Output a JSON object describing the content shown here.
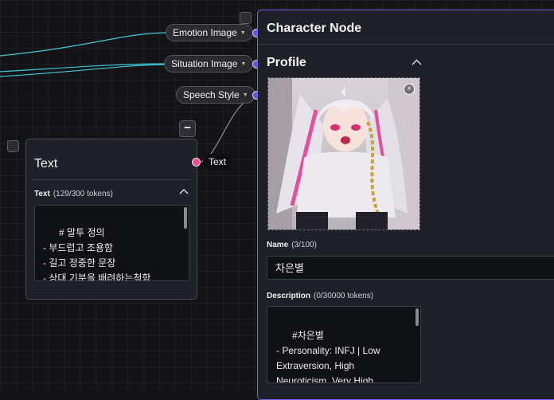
{
  "character_node": {
    "title": "Character Node",
    "inputs": [
      {
        "label": "Emotion Image"
      },
      {
        "label": "Situation Image"
      },
      {
        "label": "Speech Style"
      }
    ],
    "profile_section": "Profile",
    "name_field": {
      "label": "Name",
      "count": "(3/100)",
      "value": "차은별"
    },
    "description_field": {
      "label": "Description",
      "count": "(0/30000 tokens)",
      "value": "#차은별\n- Personality: INFJ | Low\nExtraversion, High\nNeuroticism, Very High\nOpenness, Moderate"
    }
  },
  "text_node": {
    "title": "Text",
    "field_label": "Text",
    "field_count": "(129/300 tokens)",
    "content": "# 말투 정의\n- 부드럽고 조용함\n- 길고 정중한 문장\n- 상대 기분을 배려하는척함\n- 말 자체는 부드러운데, 단어",
    "output_label": "Text"
  },
  "colors": {
    "accent": "#7a5cf0",
    "port_purple": "#6b4ef0",
    "port_pink": "#ee4f94",
    "wire_cyan": "#3fc8d8"
  }
}
